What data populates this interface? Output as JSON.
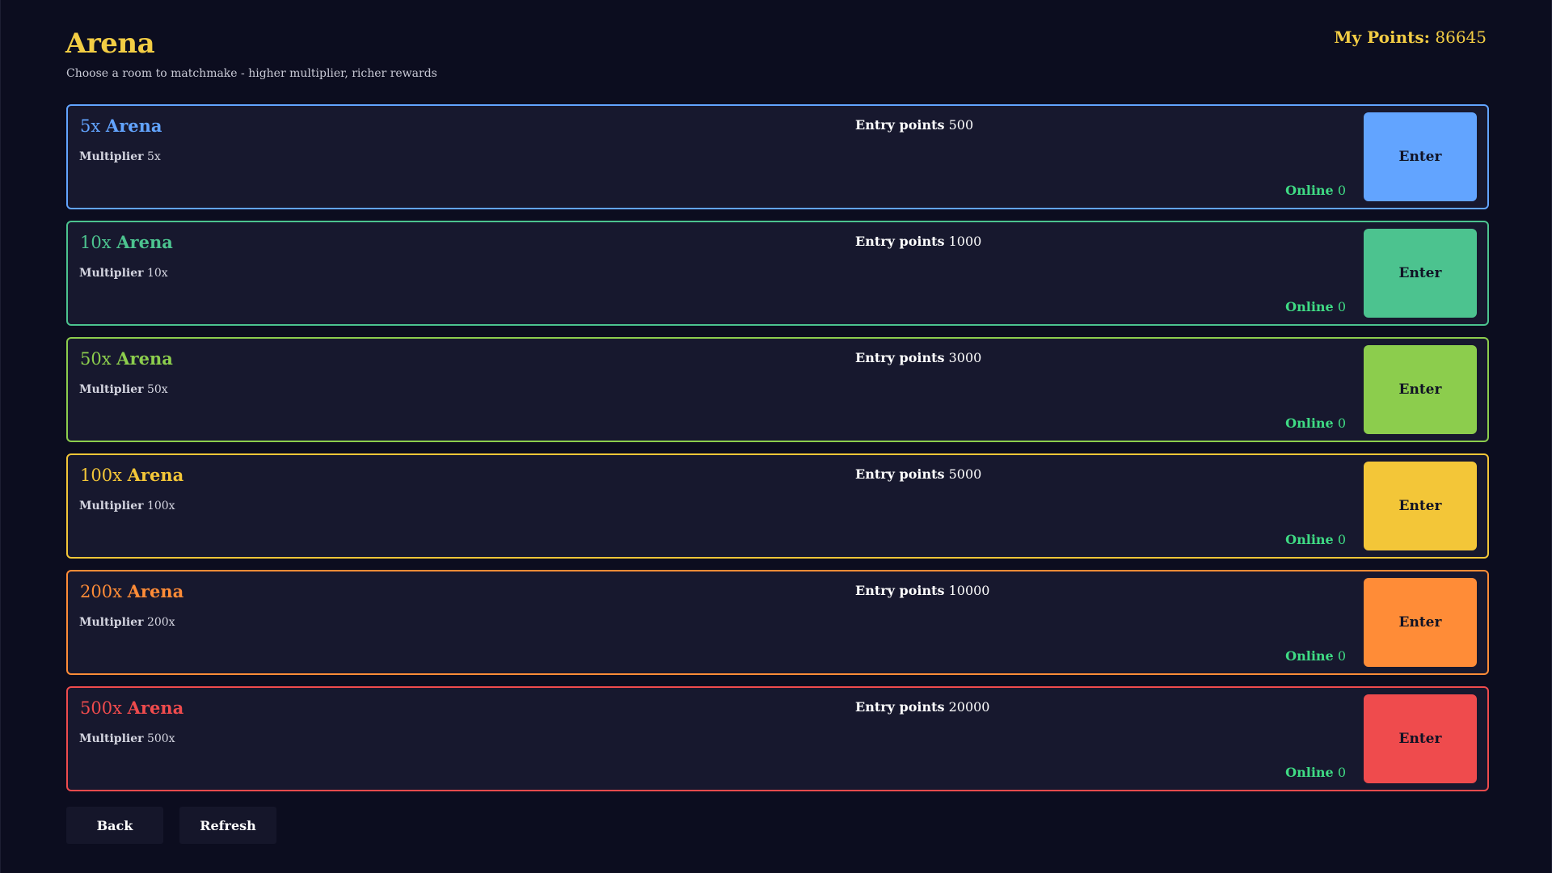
{
  "header": {
    "title": "Arena",
    "subtitle": "Choose a room to matchmake - higher multiplier, richer rewards",
    "points_label": "My Points:",
    "points_value": "86645"
  },
  "rooms": [
    {
      "mult": "5x",
      "name": "Arena",
      "multiplier_label": "Multiplier",
      "multiplier_value": "5x",
      "entry_label": "Entry points",
      "entry_value": "500",
      "online_label": "Online",
      "online_value": "0",
      "button": "Enter",
      "color": "#62a4ff"
    },
    {
      "mult": "10x",
      "name": "Arena",
      "multiplier_label": "Multiplier",
      "multiplier_value": "10x",
      "entry_label": "Entry points",
      "entry_value": "1000",
      "online_label": "Online",
      "online_value": "0",
      "button": "Enter",
      "color": "#4cc38f"
    },
    {
      "mult": "50x",
      "name": "Arena",
      "multiplier_label": "Multiplier",
      "multiplier_value": "50x",
      "entry_label": "Entry points",
      "entry_value": "3000",
      "online_label": "Online",
      "online_value": "0",
      "button": "Enter",
      "color": "#8ccd4d"
    },
    {
      "mult": "100x",
      "name": "Arena",
      "multiplier_label": "Multiplier",
      "multiplier_value": "100x",
      "entry_label": "Entry points",
      "entry_value": "5000",
      "online_label": "Online",
      "online_value": "0",
      "button": "Enter",
      "color": "#f3c638"
    },
    {
      "mult": "200x",
      "name": "Arena",
      "multiplier_label": "Multiplier",
      "multiplier_value": "200x",
      "entry_label": "Entry points",
      "entry_value": "10000",
      "online_label": "Online",
      "online_value": "0",
      "button": "Enter",
      "color": "#ff8c37"
    },
    {
      "mult": "500x",
      "name": "Arena",
      "multiplier_label": "Multiplier",
      "multiplier_value": "500x",
      "entry_label": "Entry points",
      "entry_value": "20000",
      "online_label": "Online",
      "online_value": "0",
      "button": "Enter",
      "color": "#ef4b4d"
    }
  ],
  "footer": {
    "back_label": "Back",
    "refresh_label": "Refresh"
  }
}
